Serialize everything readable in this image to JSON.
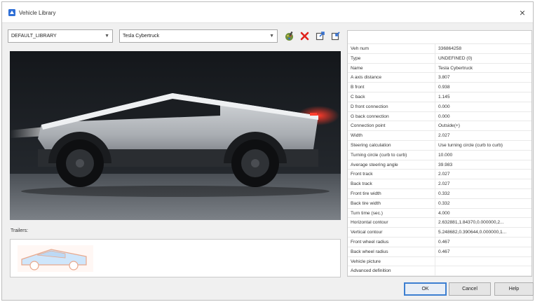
{
  "window": {
    "title": "Vehicle Library",
    "close_glyph": "×"
  },
  "selectors": {
    "library": "DEFAULT_LIBRARY",
    "vehicle": "Tesla Cybertruck"
  },
  "toolbar": {
    "icons": [
      "paint-icon",
      "delete-icon",
      "export-icon",
      "import-icon"
    ],
    "delete_color": "#e0211b"
  },
  "trailers": {
    "label": "Trailers:"
  },
  "properties": [
    {
      "name": "Veh num",
      "value": "336864258"
    },
    {
      "name": "Type",
      "value": "UNDEFINED (0)"
    },
    {
      "name": "Name",
      "value": "Tesla Cybertruck"
    },
    {
      "name": "A axis distance",
      "value": "3.807"
    },
    {
      "name": "B front",
      "value": "0.938"
    },
    {
      "name": "C back",
      "value": "1.145"
    },
    {
      "name": "D front connection",
      "value": "0.000"
    },
    {
      "name": "G back connection",
      "value": "0.000"
    },
    {
      "name": "Connection point",
      "value": "Outside(+)"
    },
    {
      "name": "Width",
      "value": "2.027"
    },
    {
      "name": "Steering calculation",
      "value": "Use turning circle (curb to curb)"
    },
    {
      "name": "Turning circle (curb to curb)",
      "value": "10.000"
    },
    {
      "name": "Average steering angle",
      "value": "39.983"
    },
    {
      "name": "Front track",
      "value": "2.027"
    },
    {
      "name": "Back track",
      "value": "2.027"
    },
    {
      "name": "Front tire width",
      "value": "0.332"
    },
    {
      "name": "Back tire width",
      "value": "0.332"
    },
    {
      "name": "Turn time (sec.)",
      "value": "4.000"
    },
    {
      "name": "Horizontal contour",
      "value": "2.632881,1.84370,0.000000,2..."
    },
    {
      "name": "Vertical contour",
      "value": "5.248682,0.390644,0.000000,1..."
    },
    {
      "name": "Front wheel radius",
      "value": "0.467"
    },
    {
      "name": "Back wheel radius",
      "value": "0.467"
    },
    {
      "name": "Vehicle picture",
      "value": ""
    },
    {
      "name": "Advanced definition",
      "value": ""
    }
  ],
  "buttons": {
    "ok": "OK",
    "cancel": "Cancel",
    "help": "Help"
  },
  "colors": {
    "accent": "#3c7fd1",
    "app_icon": "#2f6fd6"
  }
}
